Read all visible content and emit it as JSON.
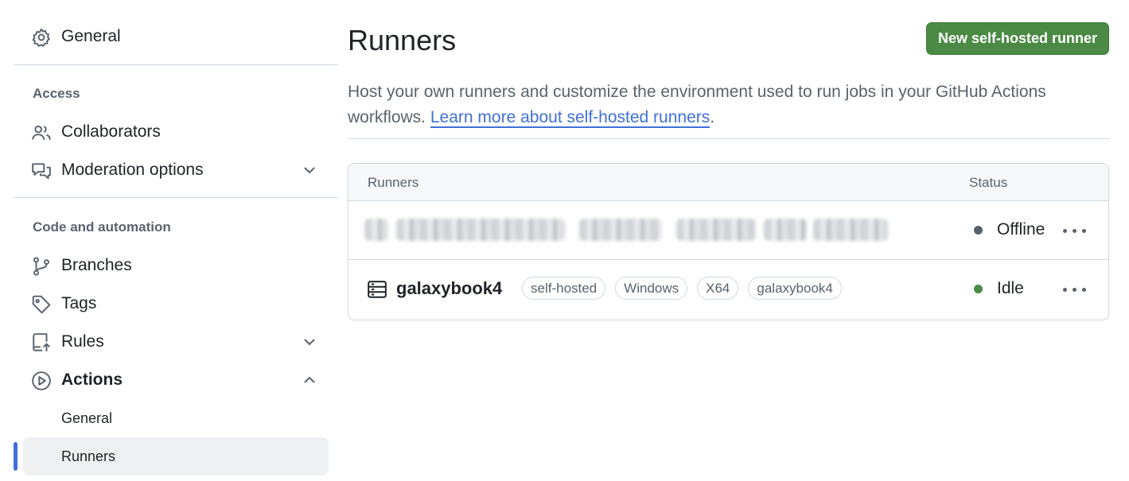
{
  "sidebar": {
    "general": "General",
    "sections": {
      "access": "Access",
      "code_automation": "Code and automation"
    },
    "items": {
      "collaborators": "Collaborators",
      "moderation": "Moderation options",
      "branches": "Branches",
      "tags": "Tags",
      "rules": "Rules",
      "actions": "Actions"
    },
    "actions_sub": {
      "general": "General",
      "runners": "Runners"
    }
  },
  "main": {
    "title": "Runners",
    "new_button": "New self-hosted runner",
    "description": "Host your own runners and customize the environment used to run jobs in your GitHub Actions workflows.",
    "learn_more": "Learn more about self-hosted runners",
    "table": {
      "col_runners": "Runners",
      "col_status": "Status",
      "rows": [
        {
          "name": "",
          "labels": [],
          "status": "Offline",
          "status_color": "#59636e",
          "redacted": true
        },
        {
          "name": "galaxybook4",
          "labels": [
            "self-hosted",
            "Windows",
            "X64",
            "galaxybook4"
          ],
          "status": "Idle",
          "status_color": "#4b8a45",
          "redacted": false
        }
      ]
    }
  },
  "colors": {
    "accent": "#4070d7",
    "primary_button": "#4b8a45"
  },
  "icons": [
    "gear-icon",
    "people-icon",
    "comment-discussion-icon",
    "git-branch-icon",
    "tag-icon",
    "repo-push-icon",
    "play-icon",
    "server-icon",
    "chevron-down-icon",
    "chevron-up-icon",
    "kebab-horizontal-icon"
  ]
}
